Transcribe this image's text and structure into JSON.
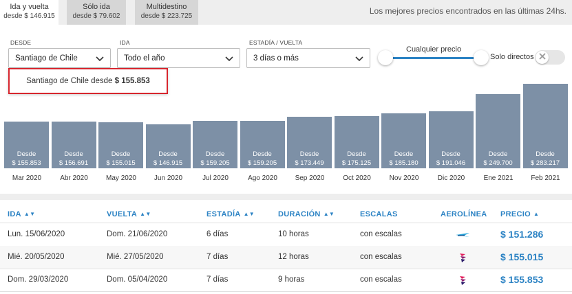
{
  "tabs": [
    {
      "title": "Ida y vuelta",
      "sub": "desde $ 146.915"
    },
    {
      "title": "Sólo ida",
      "sub": "desde $ 79.602"
    },
    {
      "title": "Multidestino",
      "sub": "desde $ 223.725"
    }
  ],
  "top_message": "Los mejores precios encontrados en las últimas 24hs.",
  "filters": {
    "desde_label": "DESDE",
    "desde_value": "Santiago de Chile",
    "ida_label": "IDA",
    "ida_value": "Todo el año",
    "estadia_label": "ESTADÍA / VUELTA",
    "estadia_value": "3 días o más",
    "price_label": "Cualquier precio",
    "directos_label": "Solo directos"
  },
  "tooltip": {
    "prefix": "Santiago de Chile desde",
    "price": "$ 155.853"
  },
  "chart_data": {
    "type": "bar",
    "categories": [
      "Mar 2020",
      "Abr 2020",
      "May 2020",
      "Jun 2020",
      "Jul 2020",
      "Ago 2020",
      "Sep 2020",
      "Oct 2020",
      "Nov 2020",
      "Dic 2020",
      "Ene 2021",
      "Feb 2021"
    ],
    "values": [
      155853,
      156691,
      155015,
      146915,
      159205,
      159205,
      173449,
      175125,
      185180,
      191046,
      249700,
      283217
    ],
    "value_labels": [
      "$ 155.853",
      "$ 156.691",
      "$ 155.015",
      "$ 146.915",
      "$ 159.205",
      "$ 159.205",
      "$ 173.449",
      "$ 175.125",
      "$ 185.180",
      "$ 191.046",
      "$ 249.700",
      "$ 283.217"
    ],
    "bar_prefix": "Desde",
    "color": "#7d90a6"
  },
  "table": {
    "headers": {
      "ida": "IDA",
      "vuelta": "VUELTA",
      "estadia": "ESTADÍA",
      "duracion": "DURACIÓN",
      "escalas": "ESCALAS",
      "aerolinea": "AEROLÍNEA",
      "precio": "PRECIO"
    },
    "rows": [
      {
        "ida": "Lun. 15/06/2020",
        "vuelta": "Dom. 21/06/2020",
        "estadia": "6 días",
        "duracion": "10 horas",
        "escalas": "con escalas",
        "airline_icon": "sky-airline-logo",
        "precio": "$ 151.286"
      },
      {
        "ida": "Mié. 20/05/2020",
        "vuelta": "Mié. 27/05/2020",
        "estadia": "7 días",
        "duracion": "12 horas",
        "escalas": "con escalas",
        "airline_icon": "latam-logo",
        "precio": "$ 155.015"
      },
      {
        "ida": "Dom. 29/03/2020",
        "vuelta": "Dom. 05/04/2020",
        "estadia": "7 días",
        "duracion": "9 horas",
        "escalas": "con escalas",
        "airline_icon": "latam-logo",
        "precio": "$ 155.853"
      }
    ]
  },
  "colors": {
    "accent": "#2c83c4",
    "bar": "#7d90a6",
    "highlight": "#d7262e"
  }
}
